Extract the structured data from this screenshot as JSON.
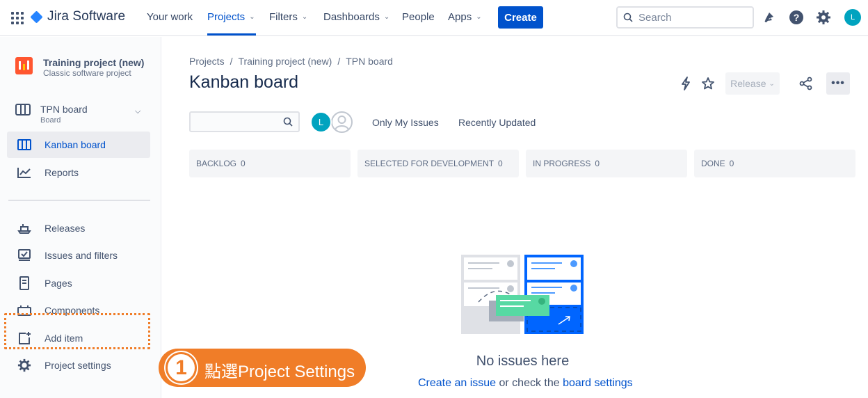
{
  "topbar": {
    "product": "Jira Software",
    "nav": [
      {
        "label": "Your work",
        "chevron": false
      },
      {
        "label": "Projects",
        "chevron": true,
        "active": true
      },
      {
        "label": "Filters",
        "chevron": true
      },
      {
        "label": "Dashboards",
        "chevron": true
      },
      {
        "label": "People",
        "chevron": false
      },
      {
        "label": "Apps",
        "chevron": true
      }
    ],
    "create_label": "Create",
    "search_placeholder": "Search",
    "avatar_initial": "L",
    "icons": [
      "notifications-icon",
      "help-icon",
      "settings-icon"
    ]
  },
  "sidebar": {
    "project_name": "Training project (new)",
    "project_type": "Classic software project",
    "board_name": "TPN board",
    "board_type": "Board",
    "items": [
      {
        "label": "Kanban board",
        "icon": "kanban-icon",
        "active": true
      },
      {
        "label": "Reports",
        "icon": "reports-icon"
      },
      {
        "label": "Releases",
        "icon": "releases-icon"
      },
      {
        "label": "Issues and filters",
        "icon": "issues-icon"
      },
      {
        "label": "Pages",
        "icon": "pages-icon"
      },
      {
        "label": "Components",
        "icon": "components-icon"
      },
      {
        "label": "Add item",
        "icon": "add-item-icon"
      },
      {
        "label": "Project settings",
        "icon": "gear-icon"
      }
    ]
  },
  "callout": {
    "number": "1",
    "text": "點選Project Settings"
  },
  "main": {
    "breadcrumb": [
      "Projects",
      "Training project (new)",
      "TPN board"
    ],
    "title": "Kanban board",
    "release_label": "Release",
    "board_avatar_initial": "L",
    "filters": [
      "Only My Issues",
      "Recently Updated"
    ],
    "columns": [
      {
        "name": "BACKLOG",
        "count": "0"
      },
      {
        "name": "SELECTED FOR DEVELOPMENT",
        "count": "0"
      },
      {
        "name": "IN PROGRESS",
        "count": "0"
      },
      {
        "name": "DONE",
        "count": "0"
      }
    ],
    "empty_title": "No issues here",
    "empty_link1": "Create an issue",
    "empty_mid": " or check the ",
    "empty_link2": "board settings"
  },
  "colors": {
    "accent": "#0052cc",
    "callout": "#f07d28",
    "avatar": "#00a3bf"
  }
}
